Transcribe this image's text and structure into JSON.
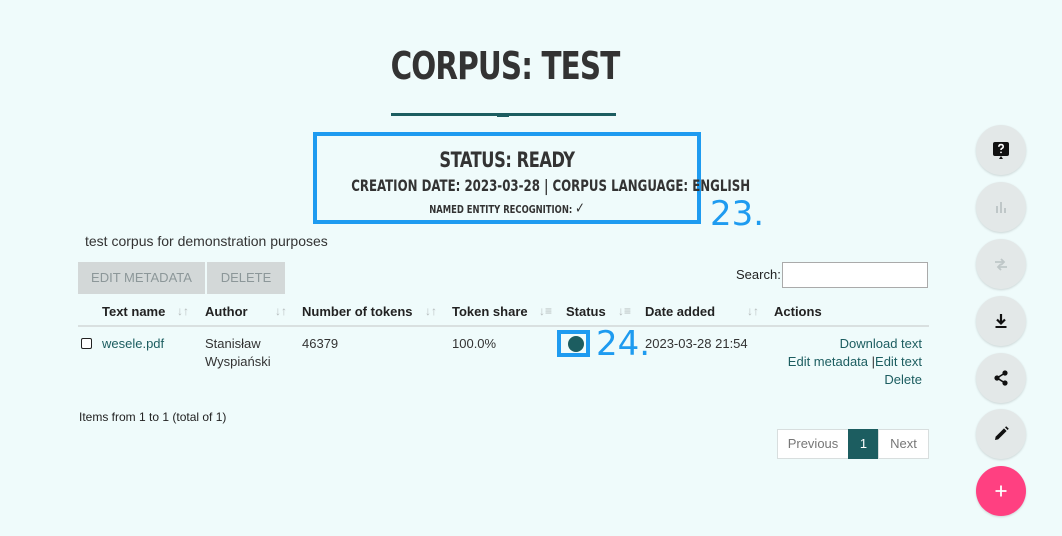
{
  "page": {
    "title": "CORPUS: TEST",
    "status": "STATUS: READY",
    "creation_info": "CREATION DATE: 2023-03-28 | CORPUS LANGUAGE: ENGLISH",
    "ner_label": "NAMED ENTITY RECOGNITION:",
    "ner_check": "✓",
    "description": "test corpus for demonstration purposes"
  },
  "annotations": {
    "a23": "23.",
    "a24": "24."
  },
  "toolbar": {
    "edit_metadata": "EDIT METADATA",
    "delete": "DELETE",
    "search_label": "Search:",
    "search_value": ""
  },
  "table": {
    "columns": [
      "Text name",
      "Author",
      "Number of tokens",
      "Token share",
      "Status",
      "Date added",
      "Actions"
    ],
    "sort_icons": [
      "↓↑",
      "↓↑",
      "↓↑",
      "↓≡",
      "↓≡",
      "↓↑"
    ],
    "rows": [
      {
        "text_name": "wesele.pdf",
        "author_line1": "Stanisław",
        "author_line2": "Wyspiański",
        "tokens": "46379",
        "share": "100.0%",
        "status": "ready",
        "date_added": "2023-03-28 21:54",
        "actions": {
          "download": "Download text",
          "edit_metadata": "Edit metadata",
          "separator": "|",
          "edit_text": "Edit text",
          "delete": "Delete"
        }
      }
    ]
  },
  "pagination": {
    "info": "Items from 1 to 1 (total of 1)",
    "previous": "Previous",
    "current": "1",
    "next": "Next"
  },
  "fab_buttons": [
    {
      "icon": "help-icon",
      "state": "active"
    },
    {
      "icon": "bar-chart-icon",
      "state": "disabled"
    },
    {
      "icon": "compare-icon",
      "state": "disabled"
    },
    {
      "icon": "download-icon",
      "state": "active"
    },
    {
      "icon": "share-icon",
      "state": "active"
    },
    {
      "icon": "edit-icon",
      "state": "active"
    },
    {
      "icon": "plus-icon",
      "state": "active"
    }
  ],
  "colors": {
    "background": "#effbfb",
    "accent": "#1c5d60",
    "annotation": "#1e9bf0",
    "fab_primary": "#ff4081"
  }
}
